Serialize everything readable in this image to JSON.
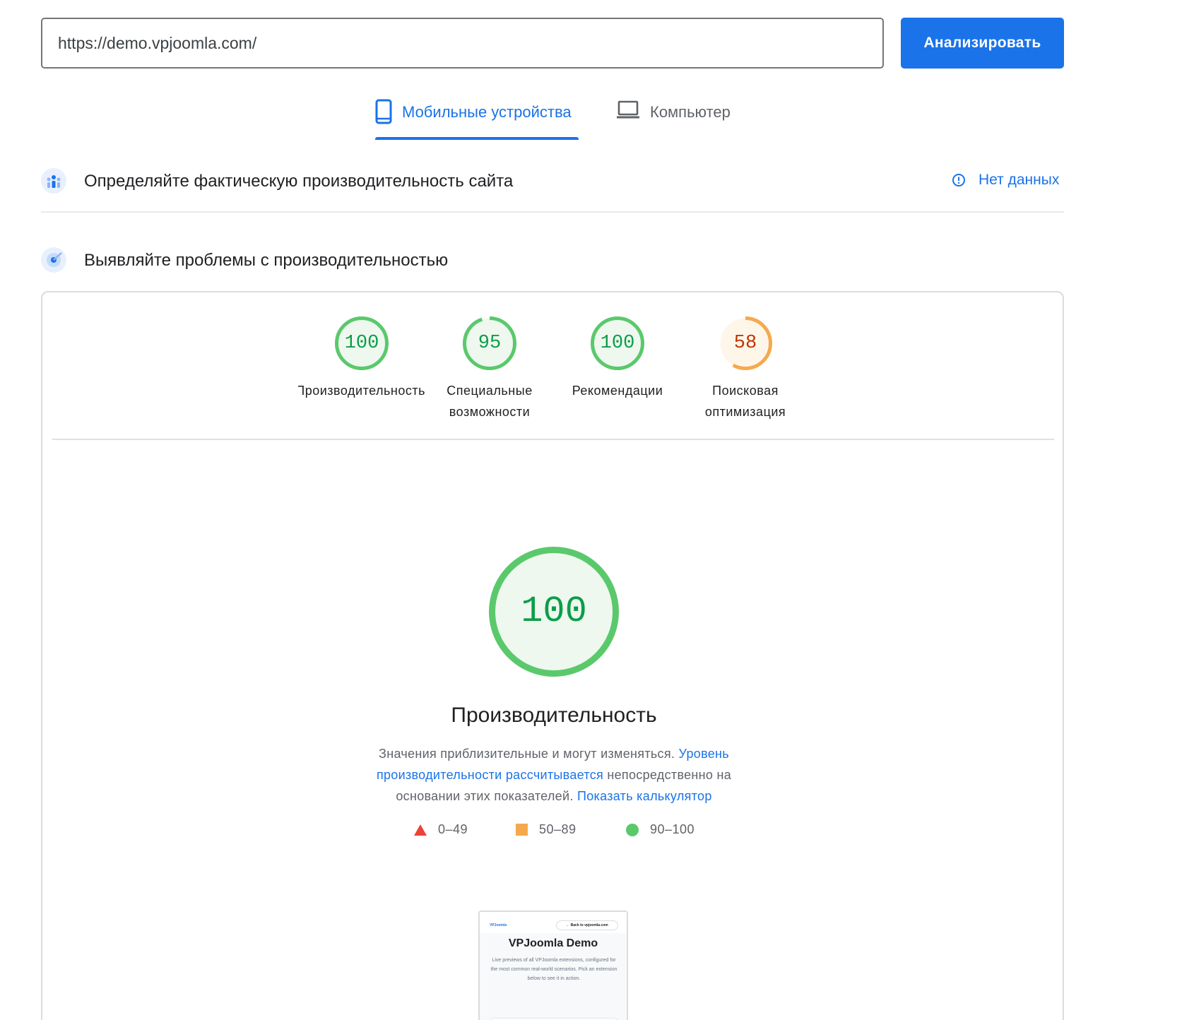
{
  "search": {
    "url_value": "https://demo.vpjoomla.com/",
    "analyze_label": "Анализировать"
  },
  "tabs": [
    {
      "label": "Мобильные устройства",
      "icon": "smartphone-icon",
      "active": true
    },
    {
      "label": "Компьютер",
      "icon": "laptop-icon",
      "active": false
    }
  ],
  "field_data": {
    "title": "Определяйте фактическую производительность сайта",
    "icon": "field-data-icon",
    "status_label": "Нет данных",
    "status_icon": "info-icon"
  },
  "lab_data": {
    "title": "Выявляйте проблемы с производительностью",
    "icon": "lab-data-icon"
  },
  "scores": [
    {
      "value": "100",
      "label": "Производительность",
      "fraction": 1.0,
      "rating": "good"
    },
    {
      "value": "95",
      "label": "Специальные возможности",
      "fraction": 0.95,
      "rating": "good"
    },
    {
      "value": "100",
      "label": "Рекомендации",
      "fraction": 1.0,
      "rating": "good"
    },
    {
      "value": "58",
      "label": "Поисковая оптимизация",
      "fraction": 0.58,
      "rating": "average"
    }
  ],
  "performance": {
    "score": "100",
    "fraction": 1.0,
    "title": "Производительность",
    "desc_text_1": "Значения приблизительные и могут изменяться.",
    "desc_link_1": "Уровень производительности рассчитывается",
    "desc_text_2": "непосредственно на основании этих показателей.",
    "desc_link_2": "Показать калькулятор"
  },
  "legend": [
    {
      "range": "0–49",
      "shape": "triangle",
      "color": "#eb4335"
    },
    {
      "range": "50–89",
      "shape": "square",
      "color": "#f4aa4c"
    },
    {
      "range": "90–100",
      "shape": "circle",
      "color": "#5ac96c"
    }
  ],
  "thumbnail": {
    "logo": "VPJoomla",
    "back_link": "← Back to vpjoomla.com",
    "title": "VPJoomla Demo",
    "text": "Live previews of all VPJoomla extensions, configured for the most common real-world scenarios. Pick an extension below to see it in action."
  },
  "colors": {
    "accent": "#1a73e8",
    "good": "#0c9d48",
    "good_ring": "#5ac96c",
    "good_fill": "#eef8ef",
    "average": "#c33300",
    "average_ring": "#f4aa4c",
    "average_fill": "#fff6ea"
  }
}
